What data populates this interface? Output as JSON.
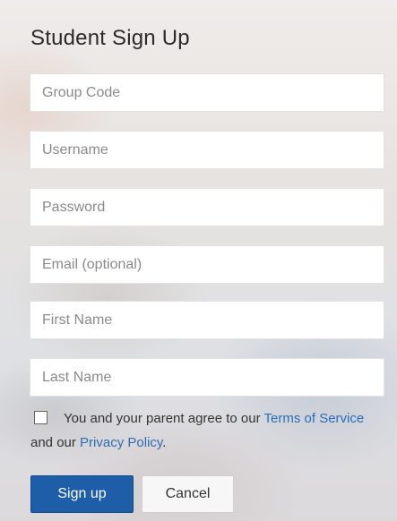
{
  "form": {
    "title": "Student Sign Up",
    "fields": [
      {
        "name": "group-code",
        "placeholder": "Group Code",
        "value": ""
      },
      {
        "name": "username",
        "placeholder": "Username",
        "value": ""
      },
      {
        "name": "password",
        "placeholder": "Password",
        "value": ""
      },
      {
        "name": "email",
        "placeholder": "Email (optional)",
        "value": ""
      },
      {
        "name": "first-name",
        "placeholder": "First Name",
        "value": ""
      },
      {
        "name": "last-name",
        "placeholder": "Last Name",
        "value": ""
      }
    ],
    "agreement": {
      "checked": false,
      "text_before": "You and your parent agree to our ",
      "terms_link": "Terms of Service",
      "text_middle": " and our ",
      "privacy_link": "Privacy Policy",
      "text_after": "."
    },
    "buttons": {
      "signup_label": "Sign up",
      "cancel_label": "Cancel"
    }
  },
  "colors": {
    "primary": "#1e5ea8",
    "link": "#2e6db4",
    "title": "#2b2b2b"
  }
}
